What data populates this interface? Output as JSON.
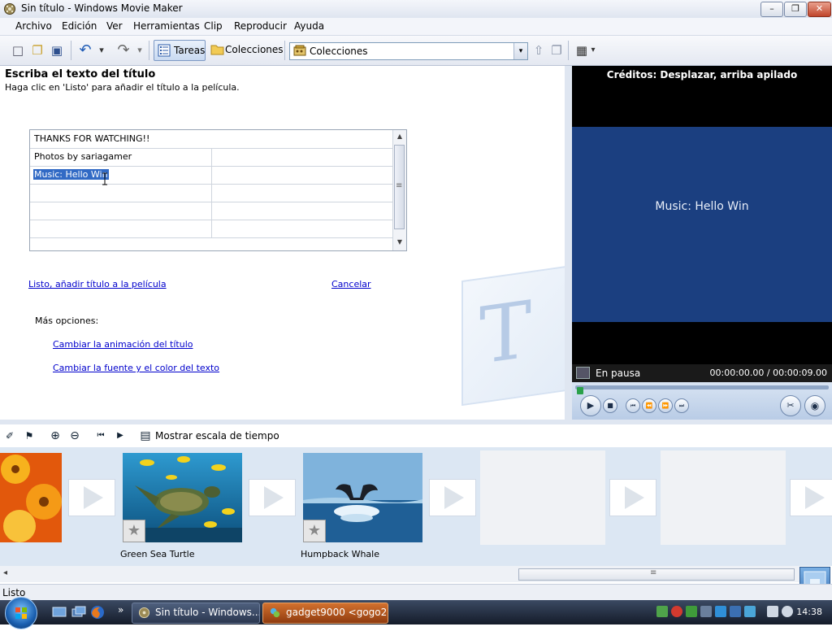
{
  "window": {
    "title": "Sin título - Windows Movie Maker",
    "minimize_glyph": "–",
    "maximize_glyph": "❐",
    "close_glyph": "✕"
  },
  "menu": [
    "Archivo",
    "Edición",
    "Ver",
    "Herramientas",
    "Clip",
    "Reproducir",
    "Ayuda"
  ],
  "toolbar": {
    "tasks_label": "Tareas",
    "collections_label": "Colecciones",
    "collections_combo_value": "Colecciones",
    "icons": {
      "new": "□",
      "open": "❐",
      "save": "▣",
      "undo": "↶",
      "redo": "↷",
      "dropdown": "▾",
      "up": "⇧",
      "new_folder": "❐",
      "views": "▦"
    }
  },
  "task_pane": {
    "heading": "Escriba el texto del título",
    "subheading": "Haga clic en 'Listo' para añadir el título a la película.",
    "grid_rows": [
      {
        "col1": "THANKS FOR WATCHING!!",
        "col2": "",
        "full": true,
        "selected": false
      },
      {
        "col1": "Photos by sariagamer",
        "col2": "",
        "full": false,
        "selected": false
      },
      {
        "col1": "Music: Hello Win",
        "col2": "",
        "full": false,
        "selected": true
      },
      {
        "col1": "",
        "col2": "",
        "full": false,
        "selected": false
      },
      {
        "col1": "",
        "col2": "",
        "full": false,
        "selected": false
      },
      {
        "col1": "",
        "col2": "",
        "full": false,
        "selected": false
      }
    ],
    "scroll_up": "▲",
    "scroll_down": "▼",
    "scroll_grip": "≡",
    "done_link": "Listo, añadir título a la película",
    "cancel_link": "Cancelar",
    "more_options_label": "Más opciones:",
    "change_animation_link": "Cambiar la animación del título",
    "change_font_link": "Cambiar la fuente y el color del texto",
    "watermark_letter": "T"
  },
  "preview": {
    "title": "Créditos: Desplazar, arriba apilado",
    "screen_text": "Music: Hello Win",
    "state": "En pausa",
    "time": "00:00:00.00 / 00:00:09.00",
    "seek_fraction": 0.0,
    "controls": {
      "play": "▶",
      "stop": "■",
      "prev": "⏮",
      "back": "⏪",
      "fwd": "⏩",
      "next": "⏭",
      "split": "✂",
      "snapshot": "◉"
    }
  },
  "storyboard_toolbar": {
    "timeline_label": "Mostrar escala de tiempo",
    "icons": {
      "narrate": "✐",
      "audio_levels": "⚑",
      "zoom_in": "⊕",
      "zoom_out": "⊖",
      "rewind": "⏮",
      "play": "▶",
      "timeline": "▤"
    }
  },
  "storyboard": {
    "clips": [
      {
        "name": "",
        "thumb_colors": [
          "#f4a31c",
          "#e0520a"
        ]
      },
      {
        "name": "Green Sea Turtle",
        "thumb_colors": [
          "#2b93c9",
          "#0f5f8f"
        ]
      },
      {
        "name": "Humpback Whale",
        "thumb_colors": [
          "#3f78b4",
          "#86b6dc"
        ]
      }
    ],
    "star_glyph": "★",
    "scroll_left": "◂",
    "scroll_grip": "≡"
  },
  "status": {
    "text": "Listo"
  },
  "taskbar": {
    "tasks": [
      {
        "label": "Sin título - Windows..."
      },
      {
        "label": "gadget9000 <gogo2..."
      }
    ],
    "overflow_glyph": "»",
    "clock": "14:38"
  }
}
